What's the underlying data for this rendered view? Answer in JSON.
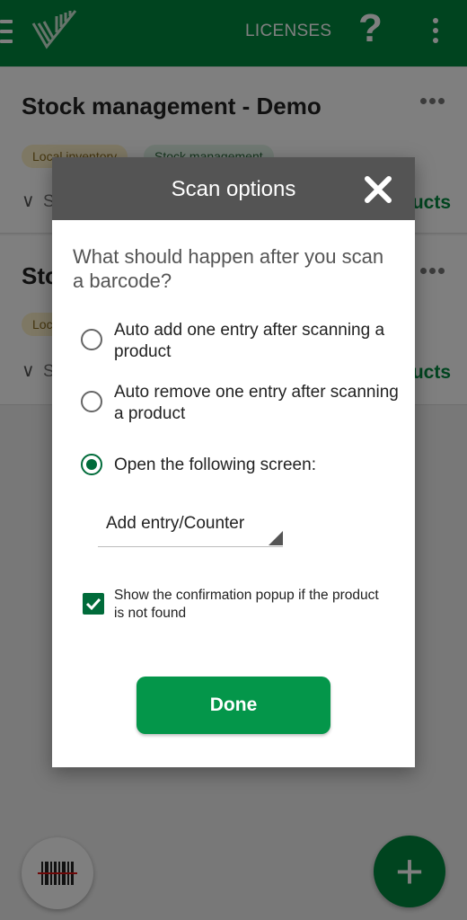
{
  "app_bar": {
    "licenses_label": "LICENSES",
    "help_label": "?"
  },
  "cards": [
    {
      "title": "Stock management - Demo",
      "tags": [
        "Local inventory",
        "Stock management"
      ],
      "summary_initial": "S",
      "action_label": "ucts"
    },
    {
      "title": "Sto",
      "tags": [
        "Loc"
      ],
      "summary_initial": "S",
      "action_label": "ucts"
    }
  ],
  "dialog": {
    "title": "Scan options",
    "question": "What should happen after you scan a barcode?",
    "options": [
      {
        "label": "Auto add one entry after scanning a product",
        "selected": false
      },
      {
        "label": "Auto remove one entry after scanning a product",
        "selected": false
      },
      {
        "label": "Open the following screen:",
        "selected": true
      }
    ],
    "screen_select_value": "Add entry/Counter",
    "confirmation_checkbox": {
      "label": "Show the confirmation popup if the product is not found",
      "checked": true
    },
    "done_label": "Done"
  },
  "fab": {
    "add_label": "+"
  },
  "colors": {
    "primary": "#00893f",
    "done_button": "#04964a",
    "dialog_header": "#545454",
    "accent_dark": "#006b3a"
  }
}
